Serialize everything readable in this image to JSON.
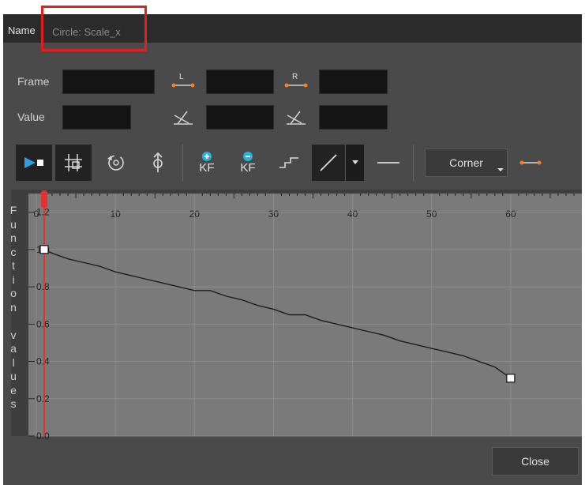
{
  "dialog": {
    "name_label": "Name",
    "name_value": "Circle: Scale_x",
    "frame_label": "Frame",
    "value_label": "Value",
    "left_handle_label": "L",
    "right_handle_label": "R",
    "kf_add_label": "KF",
    "kf_remove_label": "KF",
    "interpolation_mode": "Corner",
    "close_label": "Close",
    "y_axis_title": "Function values"
  },
  "chart_data": {
    "type": "line",
    "xlabel": "",
    "ylabel": "Function values",
    "x_ticks": [
      "0",
      "10",
      "20",
      "30",
      "40",
      "50",
      "60",
      "7"
    ],
    "y_ticks": [
      "1.2",
      "1.0",
      "0.8",
      "0.6",
      "0.4",
      "0.2",
      "0.0"
    ],
    "xlim": [
      -1,
      69
    ],
    "ylim": [
      0.0,
      1.3
    ],
    "grid": true,
    "current_frame": 1,
    "keyframes": [
      {
        "x": 1,
        "y": 1.0
      },
      {
        "x": 60,
        "y": 0.31
      }
    ],
    "series": [
      {
        "x": [
          1,
          2,
          4,
          6,
          8,
          10,
          12,
          14,
          16,
          18,
          20,
          22,
          24,
          26,
          28,
          30,
          32,
          34,
          36,
          38,
          40,
          42,
          44,
          46,
          48,
          50,
          52,
          54,
          56,
          58,
          60
        ],
        "y": [
          1.0,
          0.98,
          0.95,
          0.93,
          0.91,
          0.88,
          0.86,
          0.84,
          0.82,
          0.8,
          0.78,
          0.78,
          0.75,
          0.73,
          0.7,
          0.68,
          0.65,
          0.65,
          0.62,
          0.6,
          0.58,
          0.56,
          0.54,
          0.51,
          0.49,
          0.47,
          0.45,
          0.43,
          0.4,
          0.37,
          0.31
        ]
      }
    ],
    "colors": {
      "curve": "#1e1e1e",
      "playhead": "#e53030",
      "plot_bg": "#7a7a7a",
      "grid": "#8c8c8c"
    }
  }
}
